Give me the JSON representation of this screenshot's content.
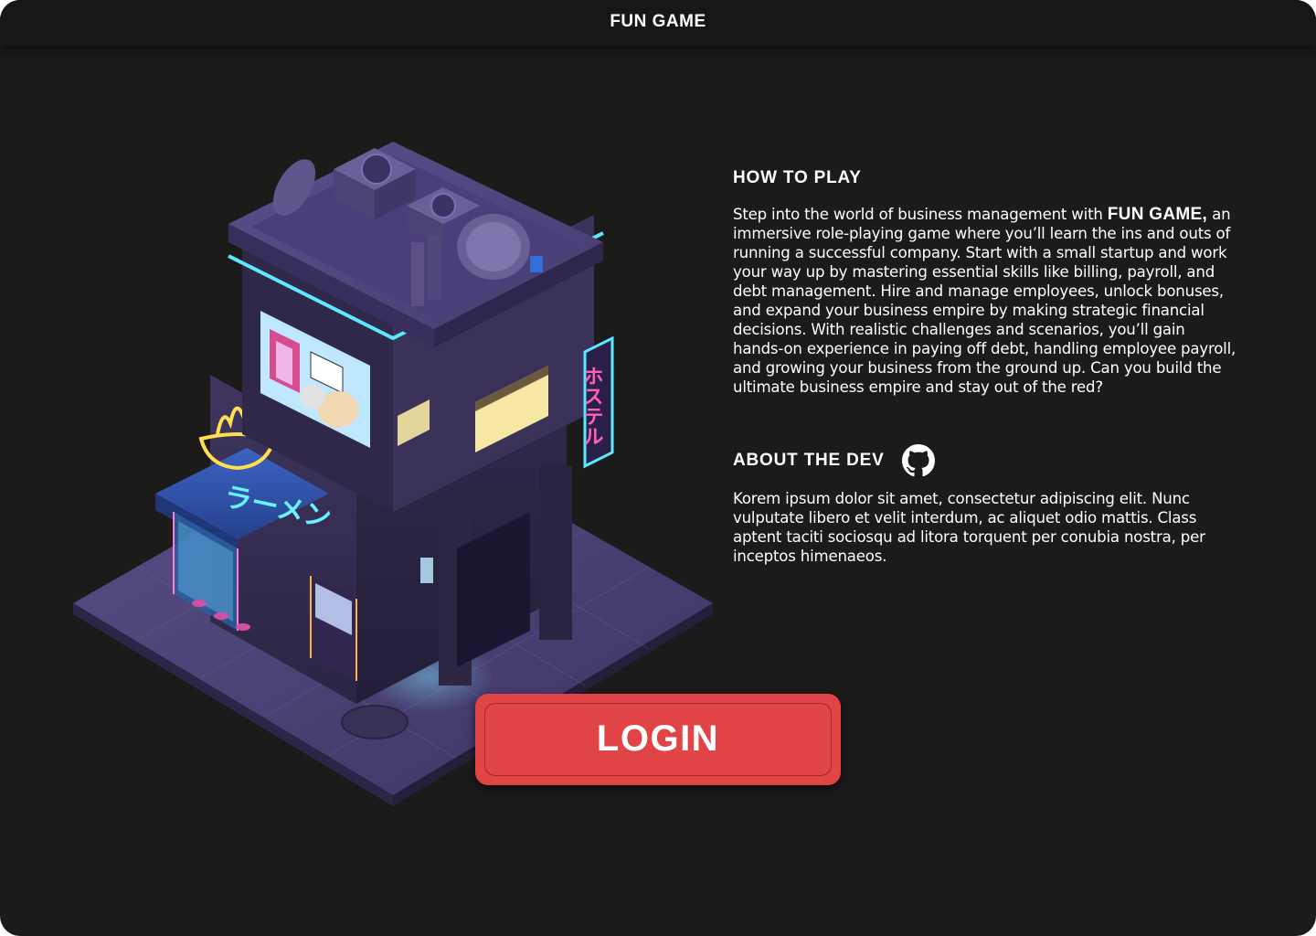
{
  "app": {
    "title": "FUN GAME"
  },
  "hero": {
    "image_name": "isometric-cyberpunk-building-illustration"
  },
  "how_to_play": {
    "heading": "HOW TO PLAY",
    "text_prefix": "Step into the world of business management with ",
    "text_bold": "FUN GAME,",
    "text_suffix": " an immersive role-playing game where you’ll learn the ins and outs of running a successful company. Start with a small startup and work your way up by mastering essential skills like billing, payroll, and debt management. Hire and manage employees, unlock bonuses, and expand your business empire by making strategic financial decisions. With realistic challenges and scenarios, you’ll gain hands-on experience in paying off debt, handling employee payroll, and growing your business from the ground up. Can you build the ultimate business empire and stay out of the red?"
  },
  "about_dev": {
    "heading": "ABOUT THE DEV",
    "icon": "github-icon",
    "text": "Korem ipsum dolor sit amet, consectetur adipiscing elit. Nunc vulputate libero et velit interdum, ac aliquet odio mattis. Class aptent taciti sociosqu ad litora torquent per conubia nostra, per inceptos himenaeos."
  },
  "login": {
    "label": "LOGIN"
  },
  "colors": {
    "background": "#1c1b1a",
    "titlebar": "#181716",
    "accent": "#e04446",
    "text": "#ffffff"
  }
}
